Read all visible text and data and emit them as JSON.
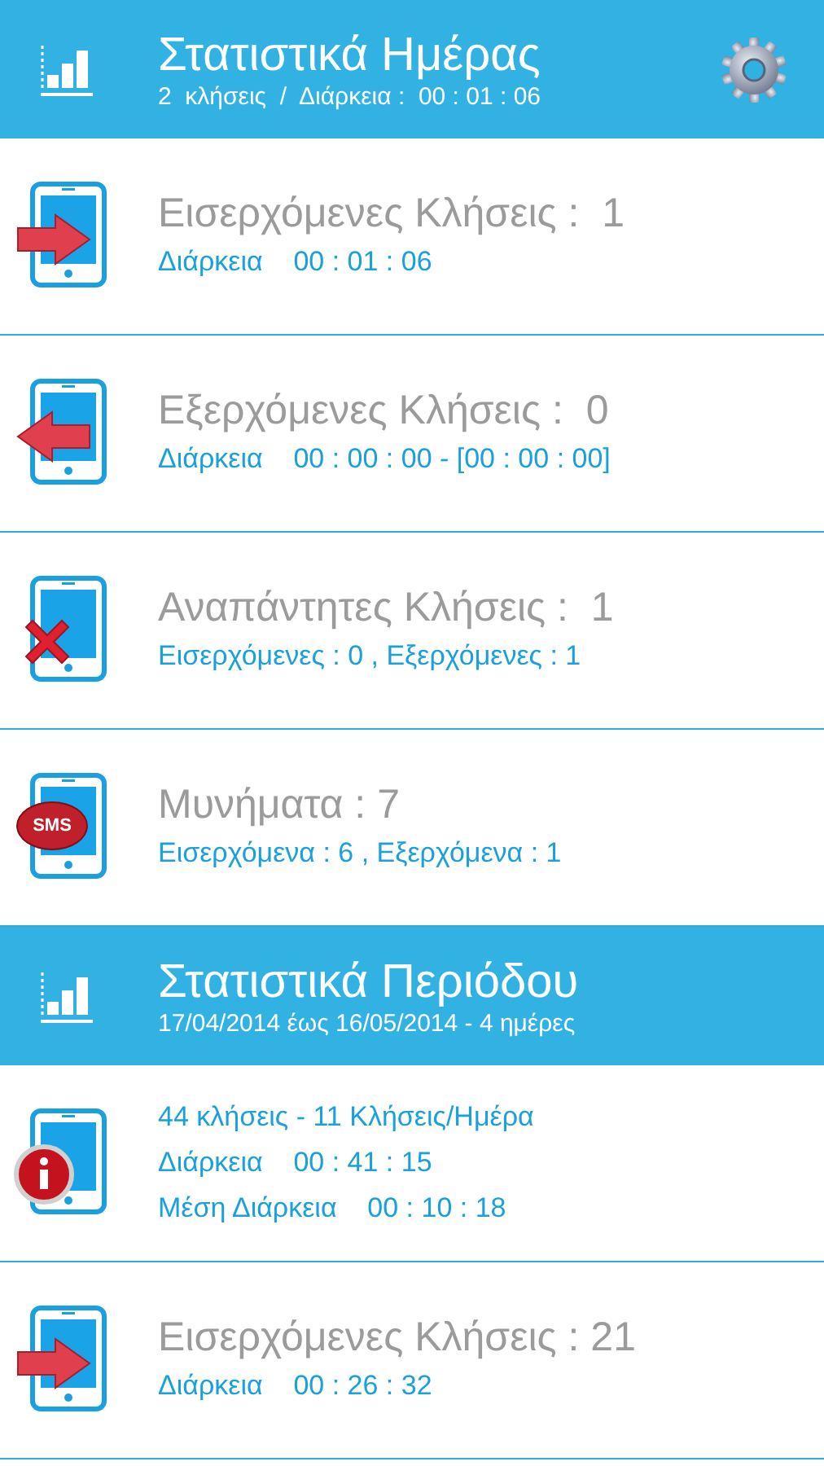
{
  "sections": [
    {
      "title": "Στατιστικά Ημέρας",
      "subtitle": "2  κλήσεις  /  Διάρκεια :  00 : 01 : 06",
      "settings": true,
      "rows": [
        {
          "kind": "incoming",
          "title": "Εισερχόμενες Κλήσεις :  1",
          "lines": [
            "Διάρκεια    00 : 01 : 06"
          ]
        },
        {
          "kind": "outgoing",
          "title": "Εξερχόμενες Κλήσεις :  0",
          "lines": [
            "Διάρκεια    00 : 00 : 00 - [00 : 00 : 00]"
          ]
        },
        {
          "kind": "missed",
          "title": "Αναπάντητες Κλήσεις :  1",
          "lines": [
            "Εισερχόμενες : 0 , Εξερχόμενες : 1"
          ]
        },
        {
          "kind": "sms",
          "badge": "SMS",
          "title": "Μυνήματα : 7",
          "lines": [
            "Εισερχόμενα : 6 , Εξερχόμενα : 1"
          ]
        }
      ]
    },
    {
      "title": "Στατιστικά Περιόδου",
      "subtitle": "17/04/2014 έως 16/05/2014 - 4 ημέρες",
      "settings": false,
      "rows": [
        {
          "kind": "info",
          "lines": [
            "44 κλήσεις - 11 Κλήσεις/Ημέρα",
            "Διάρκεια    00 : 41 : 15",
            "Μέση Διάρκεια    00 : 10 : 18"
          ]
        },
        {
          "kind": "incoming",
          "title": "Εισερχόμενες Κλήσεις : 21",
          "lines": [
            "Διάρκεια    00 : 26 : 32"
          ]
        }
      ]
    }
  ]
}
